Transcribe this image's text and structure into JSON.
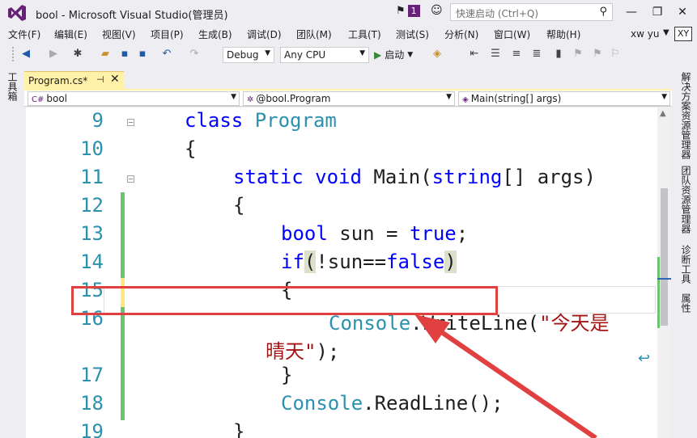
{
  "title": "bool - Microsoft Visual Studio(管理员)",
  "notifications": {
    "count": "1"
  },
  "quick_launch": {
    "placeholder": "快速启动 (Ctrl+Q)"
  },
  "window_controls": {
    "minimize": "—",
    "restore": "❐",
    "close": "✕"
  },
  "menu": [
    "文件(F)",
    "编辑(E)",
    "视图(V)",
    "项目(P)",
    "生成(B)",
    "调试(D)",
    "团队(M)",
    "工具(T)",
    "测试(S)",
    "分析(N)",
    "窗口(W)",
    "帮助(H)"
  ],
  "account": {
    "name": "xw yu",
    "initials": "XY"
  },
  "toolbar": {
    "config": "Debug",
    "platform": "Any CPU",
    "start_label": "启动"
  },
  "left_panel": {
    "toolbox_label": "工具箱"
  },
  "right_panel": {
    "tabs": [
      "解决方案资源管理器",
      "团队资源管理器",
      "诊断工具",
      "属性"
    ]
  },
  "document_tab": {
    "label": "Program.cs*"
  },
  "navbar": {
    "project": "bool",
    "type": "@bool.Program",
    "member": "Main(string[] args)"
  },
  "editor": {
    "line_numbers": [
      "9",
      "10",
      "11",
      "12",
      "13",
      "14",
      "15",
      "16",
      "17",
      "18",
      "19"
    ],
    "lines": {
      "l9_kw": "class",
      "l9_type": "Program",
      "l10": "{",
      "l11_kw1": "static",
      "l11_kw2": "void",
      "l11_name": "Main(",
      "l11_kw3": "string",
      "l11_rest": "[] args)",
      "l12": "{",
      "l13_kw1": "bool",
      "l13_mid": " sun = ",
      "l13_kw2": "true",
      "l13_end": ";",
      "l14_kw": "if",
      "l14_open": "(",
      "l14_mid": "!sun==",
      "l14_kw2": "false",
      "l14_close": ")",
      "l15": "{",
      "l16_type": "Console",
      "l16_method": ".WriteLine(",
      "l16_str": "\"今天是",
      "l16b_str": "晴天\"",
      "l16b_end": ");",
      "l17": "}",
      "l18_type": "Console",
      "l18_method": ".ReadLine();",
      "l19": "}"
    }
  },
  "colors": {
    "keyword": "#0000ff",
    "type": "#2b91af",
    "string": "#a31515",
    "annotation": "#e04040",
    "accent": "#68217a"
  }
}
